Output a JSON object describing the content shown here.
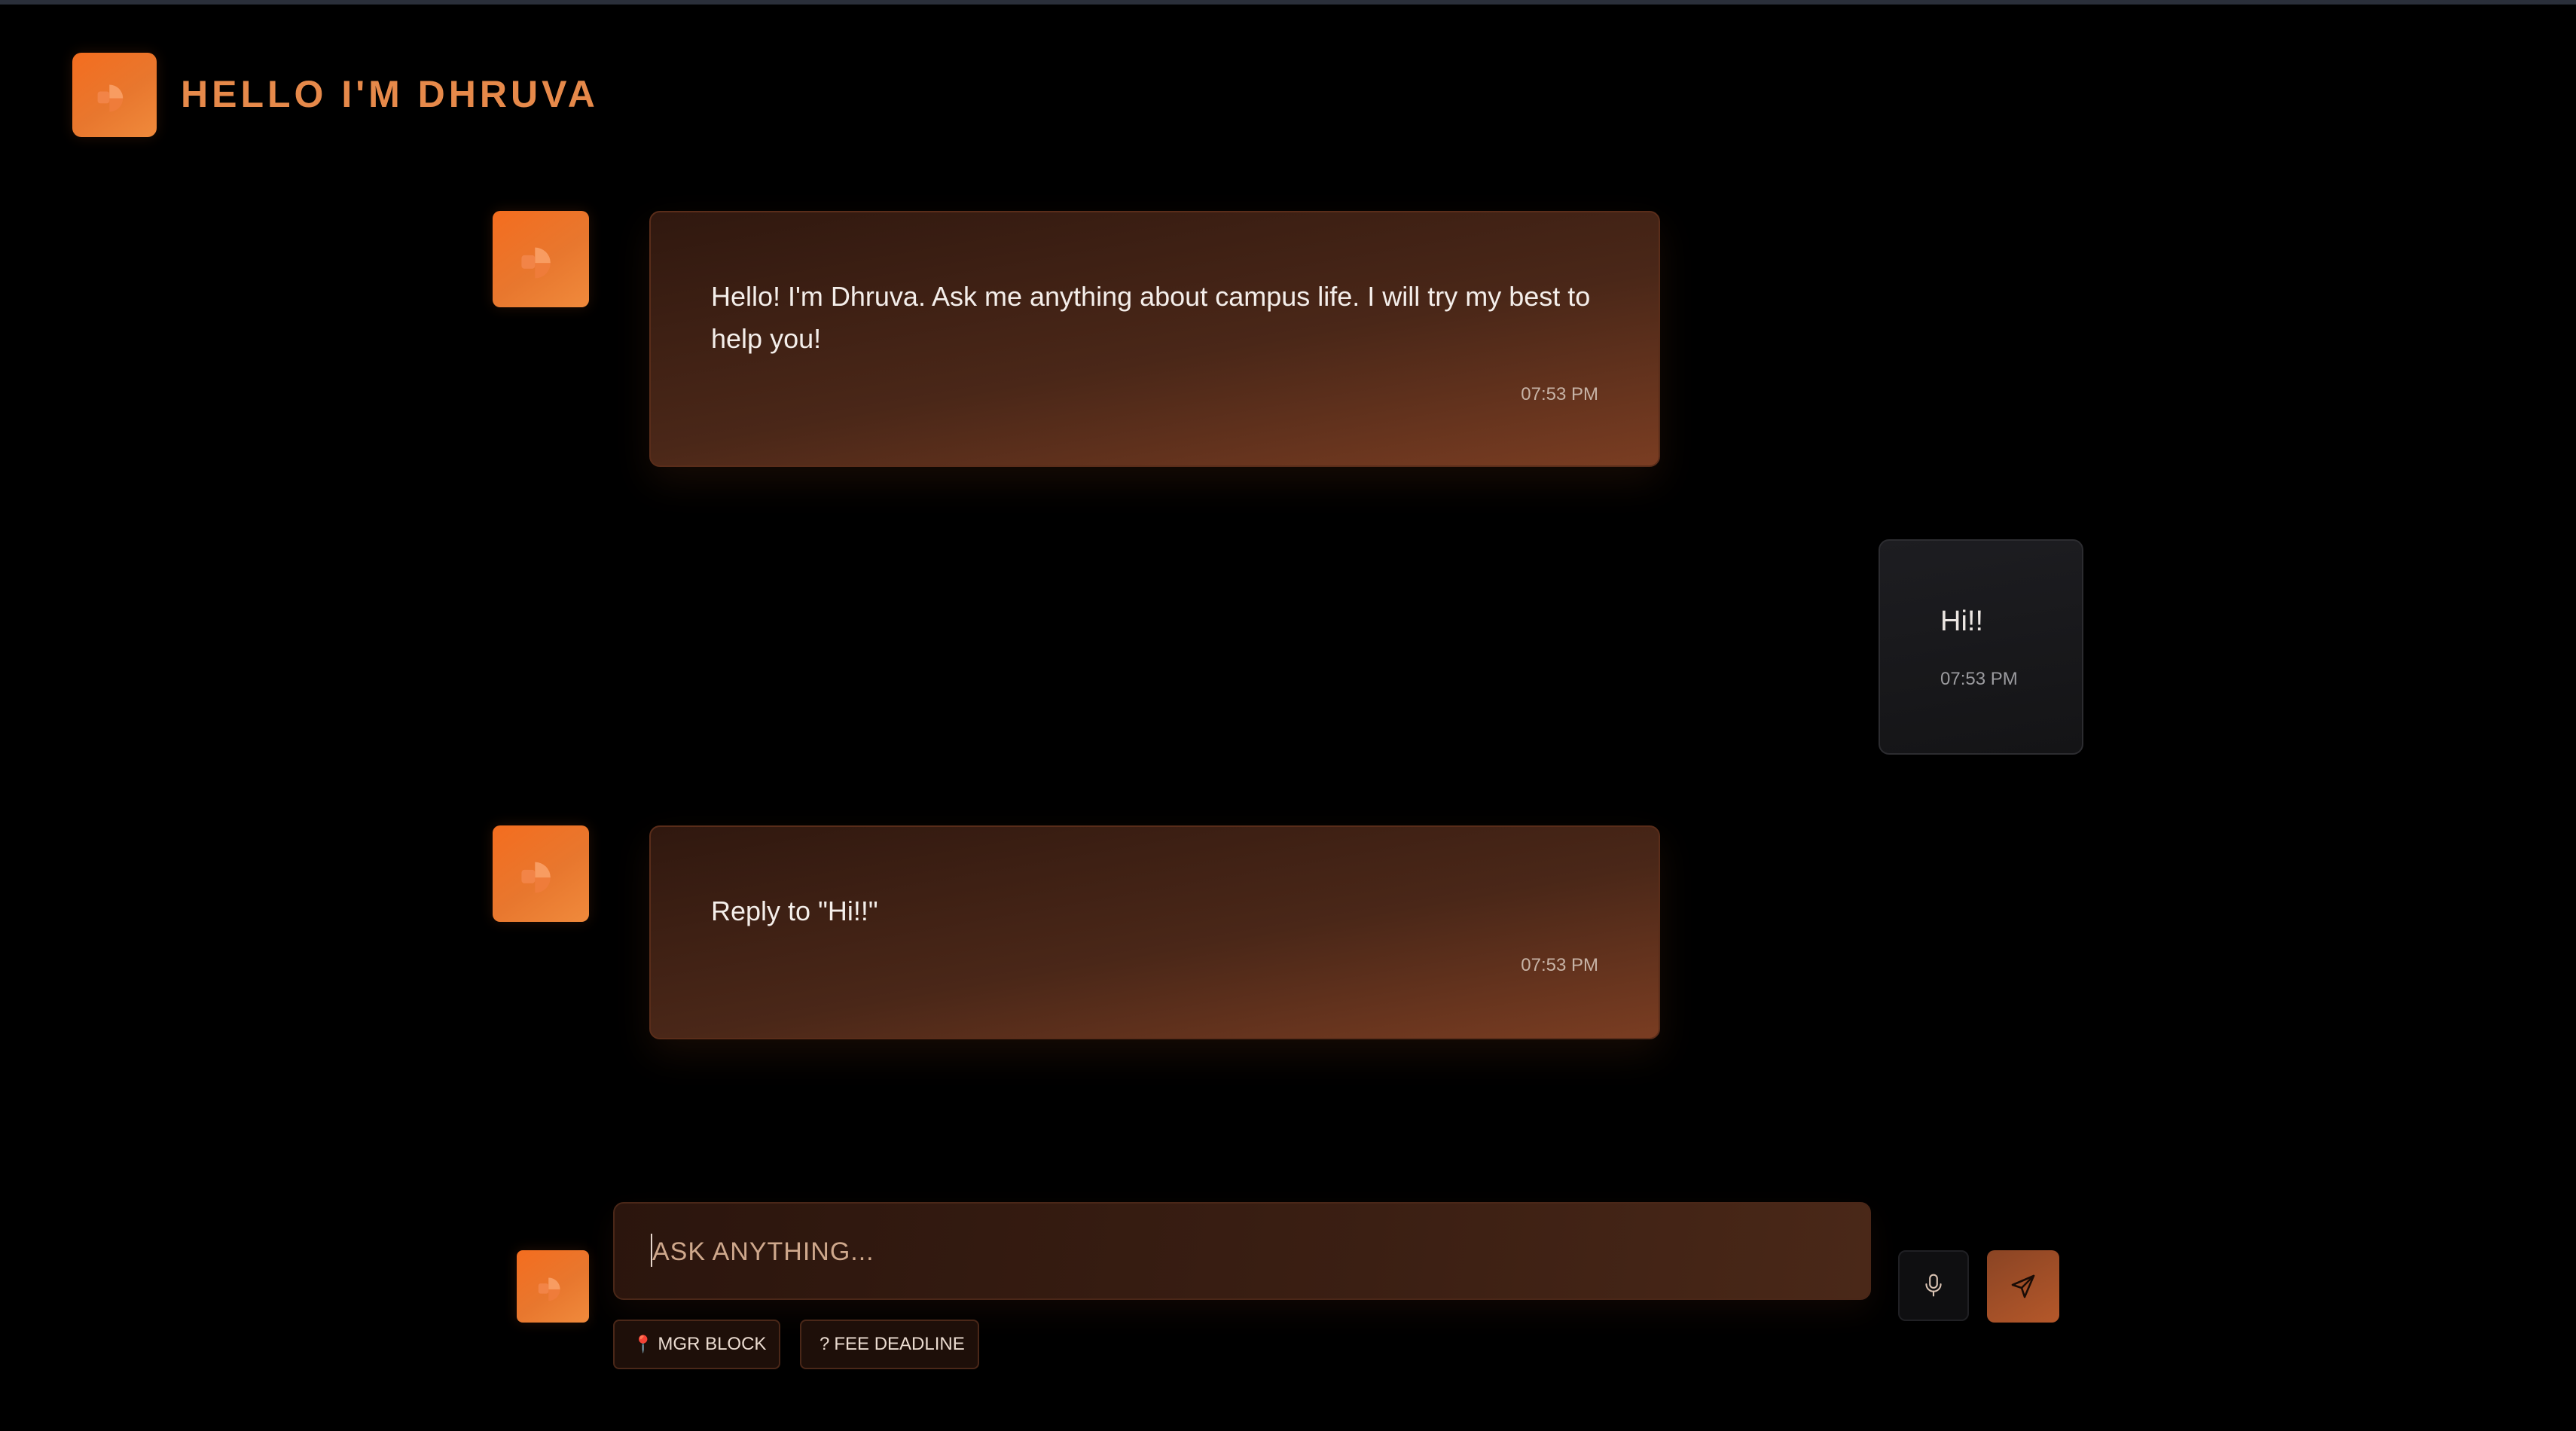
{
  "header": {
    "title": "HELLO I'M DHRUVA"
  },
  "messages": [
    {
      "sender": "bot",
      "text": "Hello! I'm Dhruva. Ask me anything about campus life. I will try my best to help you!",
      "time": "07:53 PM"
    },
    {
      "sender": "user",
      "text": "Hi!!",
      "time": "07:53 PM"
    },
    {
      "sender": "bot",
      "text": "Reply to \"Hi!!\"",
      "time": "07:53 PM"
    }
  ],
  "composer": {
    "placeholder": "ASK ANYTHING...",
    "value": "",
    "mic_icon": "microphone-icon",
    "send_icon": "send-icon"
  },
  "quick_replies": [
    {
      "icon": "pin-icon",
      "label": "MGR BLOCK"
    },
    {
      "icon": "question-icon",
      "label": "FEE DEADLINE"
    }
  ],
  "colors": {
    "background": "#000000",
    "accent": "#f46d1f",
    "title": "#e6894a",
    "bot_bubble": "#4a2718",
    "user_bubble": "#1a1a1d"
  }
}
